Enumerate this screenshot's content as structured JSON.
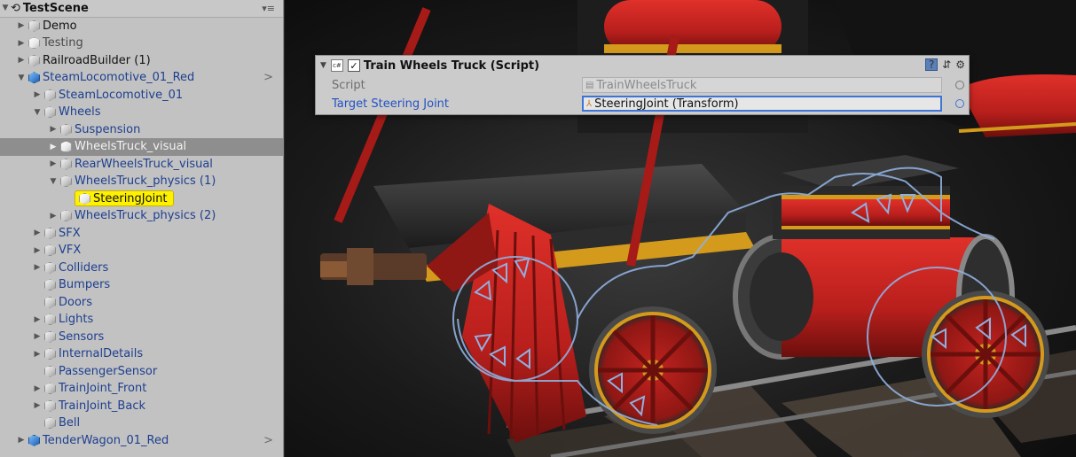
{
  "hierarchy": {
    "scene_name": "TestScene",
    "items": [
      {
        "label": "Demo",
        "indent": 0
      },
      {
        "label": "Testing",
        "indent": 0
      },
      {
        "label": "RailroadBuilder (1)",
        "indent": 0
      },
      {
        "label": "SteamLocomotive_01_Red",
        "indent": 0
      },
      {
        "label": "SteamLocomotive_01",
        "indent": 1
      },
      {
        "label": "Wheels",
        "indent": 1
      },
      {
        "label": "Suspension",
        "indent": 2
      },
      {
        "label": "WheelsTruck_visual",
        "indent": 2
      },
      {
        "label": "RearWheelsTruck_visual",
        "indent": 2
      },
      {
        "label": "WheelsTruck_physics (1)",
        "indent": 2
      },
      {
        "label": "SteeringJoint",
        "indent": 3
      },
      {
        "label": "WheelsTruck_physics (2)",
        "indent": 2
      },
      {
        "label": "SFX",
        "indent": 1
      },
      {
        "label": "VFX",
        "indent": 1
      },
      {
        "label": "Colliders",
        "indent": 1
      },
      {
        "label": "Bumpers",
        "indent": 1
      },
      {
        "label": "Doors",
        "indent": 1
      },
      {
        "label": "Lights",
        "indent": 1
      },
      {
        "label": "Sensors",
        "indent": 1
      },
      {
        "label": "InternalDetails",
        "indent": 1
      },
      {
        "label": "PassengerSensor",
        "indent": 1
      },
      {
        "label": "TrainJoint_Front",
        "indent": 1
      },
      {
        "label": "TrainJoint_Back",
        "indent": 1
      },
      {
        "label": "Bell",
        "indent": 1
      },
      {
        "label": "TenderWagon_01_Red",
        "indent": 0
      }
    ]
  },
  "inspector": {
    "component_title": "Train Wheels Truck (Script)",
    "enabled": true,
    "fields": [
      {
        "name": "Script",
        "value": "TrainWheelsTruck"
      },
      {
        "name": "Target Steering Joint",
        "value": "SteeringJoint (Transform)"
      }
    ]
  },
  "colors": {
    "selection_highlight": "#fff200",
    "prefab_blue_text": "#1d3f8f",
    "active_field_border": "#3d74d6"
  }
}
